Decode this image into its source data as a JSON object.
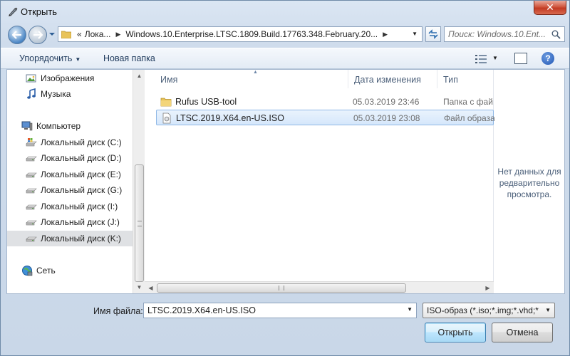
{
  "window": {
    "title": "Открыть"
  },
  "address": {
    "segments": [
      "«",
      "Лока...",
      "Windows.10.Enterprise.LTSC.1809.Build.17763.348.February.20..."
    ]
  },
  "search": {
    "placeholder": "Поиск: Windows.10.Ent..."
  },
  "toolbar": {
    "organize": "Упорядочить",
    "new_folder": "Новая папка"
  },
  "navpane": {
    "items": [
      {
        "label": "Изображения",
        "icon": "pictures-icon"
      },
      {
        "label": "Музыка",
        "icon": "music-icon"
      },
      {
        "label": "Компьютер",
        "icon": "computer-icon"
      },
      {
        "label": "Локальный диск (C:)",
        "icon": "system-drive-icon"
      },
      {
        "label": "Локальный диск (D:)",
        "icon": "drive-icon"
      },
      {
        "label": "Локальный диск (E:)",
        "icon": "drive-icon"
      },
      {
        "label": "Локальный диск (G:)",
        "icon": "drive-icon"
      },
      {
        "label": "Локальный диск (I:)",
        "icon": "drive-icon"
      },
      {
        "label": "Локальный диск (J:)",
        "icon": "drive-icon"
      },
      {
        "label": "Локальный диск (K:)",
        "icon": "drive-icon",
        "selected": true
      },
      {
        "label": "Сеть",
        "icon": "network-icon"
      }
    ]
  },
  "filelist": {
    "columns": {
      "name": "Имя",
      "date": "Дата изменения",
      "type": "Тип"
    },
    "rows": [
      {
        "name": "Rufus USB-tool",
        "date": "05.03.2019 23:46",
        "type": "Папка с фай...",
        "icon": "folder-icon"
      },
      {
        "name": "LTSC.2019.X64.en-US.ISO",
        "date": "05.03.2019 23:08",
        "type": "Файл образа...",
        "icon": "iso-file-icon",
        "selected": true
      }
    ]
  },
  "preview": {
    "message_lines": [
      "Нет данных для",
      "редварительно",
      "просмотра."
    ]
  },
  "bottom": {
    "filename_label": "Имя файла:",
    "filename_value": "LTSC.2019.X64.en-US.ISO",
    "filetype": "ISO-образ (*.iso;*.img;*.vhd;*",
    "open_button": "Открыть",
    "cancel_button": "Отмена"
  },
  "colors": {
    "accent": "#1f56b5",
    "selection": "#d5e7fb",
    "close": "#c23a23"
  }
}
